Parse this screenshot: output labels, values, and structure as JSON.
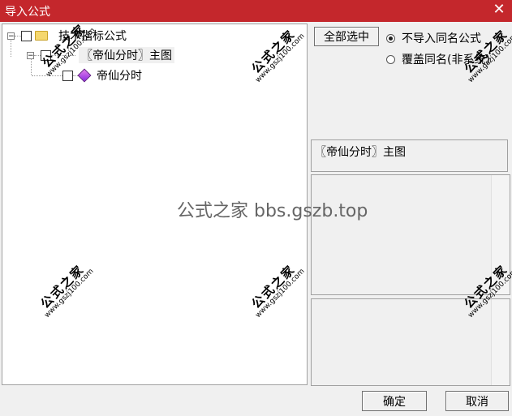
{
  "window": {
    "title": "导入公式",
    "close_icon": "close-icon"
  },
  "tree": {
    "root": {
      "label": "技术指标公式",
      "icon": "folder-icon"
    },
    "child": {
      "label": "〖帝仙分时〗主图"
    },
    "leaf": {
      "label": "帝仙分时",
      "icon": "formula-gem-icon"
    }
  },
  "options": {
    "select_all": "全部选中",
    "radio_skip": "不导入同名公式",
    "radio_overwrite": "覆盖同名(非系统)",
    "selected": "radio_skip"
  },
  "info": {
    "formula_name": "〖帝仙分时〗主图"
  },
  "buttons": {
    "ok": "确定",
    "cancel": "取消"
  },
  "watermark": {
    "center": "公式之家 bbs.gszb.top",
    "stamp_big": "公式之家",
    "stamp_small": "www.gszj100.com"
  }
}
